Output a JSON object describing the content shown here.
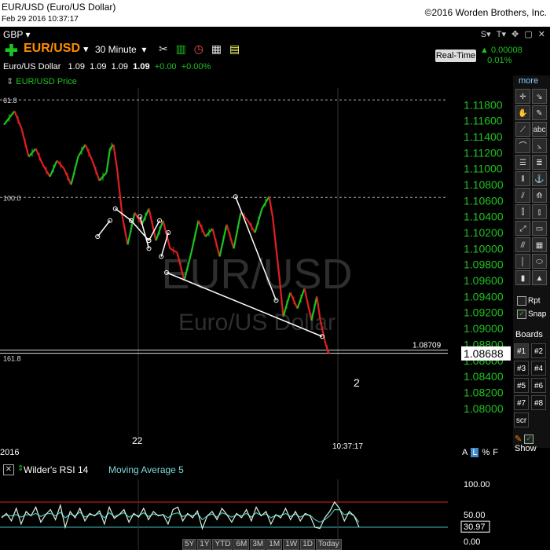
{
  "window": {
    "title": "EUR/USD (Euro/US Dollar)",
    "datetime": "Feb 29 2016 10:37:17",
    "copyright": "©2016 Worden Brothers, Inc."
  },
  "toolbar": {
    "watchlist": "GBP",
    "symbol": "EUR/USD",
    "interval": "30 Minute",
    "realtime_label": "Real-Time",
    "change_abs": "0.00008",
    "change_pct": "0.01%",
    "top_icons": [
      "S▾",
      "T▾",
      "✥",
      "▢",
      "✕"
    ],
    "tool_icons": [
      "tools-icon",
      "bar-chart-icon",
      "clock-icon",
      "grid-icon",
      "note-icon"
    ]
  },
  "quote": {
    "name": "Euro/US Dollar",
    "open": "1.09",
    "high": "1.09",
    "low": "1.09",
    "close": "1.09",
    "change": "+0.00",
    "change_pct": "+0.00%"
  },
  "price_pane": {
    "label": "EUR/USD Price",
    "watermark_symbol": "EUR/USD",
    "watermark_name": "Euro/US Dollar",
    "current_price_box": "1.08688",
    "line_value_label": "1.08709",
    "wave_label": "2",
    "date_label_left": "2016",
    "date_label_22": "22",
    "date_label_time": "10:37:17",
    "fib_labels": [
      "61.8",
      "100.0",
      "161.8"
    ]
  },
  "chart_data": {
    "type": "line",
    "title": "EUR/USD (Euro/US Dollar)",
    "interval": "30 Minute",
    "yaxis_ticks": [
      1.118,
      1.116,
      1.114,
      1.112,
      1.11,
      1.108,
      1.106,
      1.104,
      1.102,
      1.1,
      1.098,
      1.096,
      1.094,
      1.092,
      1.09,
      1.088,
      1.086,
      1.084,
      1.082,
      1.08
    ],
    "ylim": [
      1.0788,
      1.1195
    ],
    "x_labels": [
      "2016",
      "22",
      "10:37:17"
    ],
    "horizontal_lines": [
      {
        "label": "61.8",
        "value": 1.1186
      },
      {
        "label": "100.0",
        "value": 1.1064
      },
      {
        "label": "161.8",
        "value": 1.0871
      }
    ],
    "price_path": [
      [
        0,
        1.1155
      ],
      [
        0.03,
        1.1172
      ],
      [
        0.05,
        1.115
      ],
      [
        0.07,
        1.1115
      ],
      [
        0.09,
        1.1125
      ],
      [
        0.11,
        1.1105
      ],
      [
        0.13,
        1.109
      ],
      [
        0.15,
        1.111
      ],
      [
        0.17,
        1.11
      ],
      [
        0.19,
        1.108
      ],
      [
        0.21,
        1.1115
      ],
      [
        0.23,
        1.113
      ],
      [
        0.25,
        1.111
      ],
      [
        0.27,
        1.1085
      ],
      [
        0.29,
        1.1095
      ],
      [
        0.3,
        1.1125
      ],
      [
        0.31,
        1.113
      ],
      [
        0.32,
        1.11
      ],
      [
        0.335,
        1.104
      ],
      [
        0.35,
        1.1005
      ],
      [
        0.37,
        1.1045
      ],
      [
        0.39,
        1.103
      ],
      [
        0.41,
        1.105
      ],
      [
        0.43,
        1.101
      ],
      [
        0.45,
        1.1035
      ],
      [
        0.47,
        1.1
      ],
      [
        0.49,
        1.0995
      ],
      [
        0.51,
        1.096
      ],
      [
        0.53,
        1.0995
      ],
      [
        0.55,
        1.1035
      ],
      [
        0.57,
        1.1015
      ],
      [
        0.59,
        1.1025
      ],
      [
        0.61,
        1.099
      ],
      [
        0.63,
        1.103
      ],
      [
        0.65,
        1.1
      ],
      [
        0.67,
        1.1045
      ],
      [
        0.69,
        1.1035
      ],
      [
        0.71,
        1.102
      ],
      [
        0.73,
        1.105
      ],
      [
        0.75,
        1.1065
      ],
      [
        0.76,
        1.104
      ],
      [
        0.77,
        1.1
      ],
      [
        0.78,
        1.096
      ],
      [
        0.79,
        1.0915
      ],
      [
        0.81,
        1.0945
      ],
      [
        0.83,
        1.0925
      ],
      [
        0.85,
        1.095
      ],
      [
        0.87,
        1.091
      ],
      [
        0.885,
        1.094
      ],
      [
        0.895,
        1.091
      ],
      [
        0.91,
        1.088
      ],
      [
        0.92,
        1.0868
      ]
    ],
    "trendlines": [
      {
        "from": [
          0.265,
          1.1015
        ],
        "to": [
          0.3,
          1.1035
        ]
      },
      {
        "from": [
          0.315,
          1.105
        ],
        "to": [
          0.36,
          1.1035
        ]
      },
      {
        "from": [
          0.36,
          1.1035
        ],
        "to": [
          0.41,
          1.101
        ]
      },
      {
        "from": [
          0.41,
          1.101
        ],
        "to": [
          0.44,
          1.1035
        ]
      },
      {
        "from": [
          0.385,
          1.104
        ],
        "to": [
          0.41,
          1.1
        ]
      },
      {
        "from": [
          0.445,
          1.099
        ],
        "to": [
          0.465,
          1.102
        ]
      },
      {
        "from": [
          0.46,
          1.097
        ],
        "to": [
          0.9,
          1.089
        ]
      },
      {
        "from": [
          0.655,
          1.1065
        ],
        "to": [
          0.77,
          1.0935
        ]
      }
    ]
  },
  "rsi_pane": {
    "title": "Wilder's RSI 14",
    "ma_label": "Moving Average 5",
    "levels": [
      "100.00",
      "50.00",
      "0.00"
    ],
    "current": "30.97",
    "upper_line": 70,
    "lower_line": 30,
    "rsi_values": [
      45,
      52,
      40,
      60,
      35,
      55,
      48,
      62,
      38,
      50,
      58,
      42,
      65,
      30,
      55,
      45,
      60,
      40,
      52,
      48,
      56,
      35,
      62,
      44,
      50,
      58,
      38,
      52,
      46,
      60,
      42,
      55,
      48,
      50,
      35,
      58,
      62,
      40,
      52,
      45,
      56,
      28,
      48,
      55,
      42,
      60,
      50,
      38,
      52,
      45,
      58,
      40,
      62,
      48,
      55,
      35,
      50,
      45,
      60,
      42,
      55,
      40,
      52,
      48,
      30,
      28,
      45,
      55,
      70,
      60,
      40,
      55,
      48,
      30
    ],
    "ma_values": [
      47,
      49,
      48,
      50,
      46,
      50,
      49,
      52,
      47,
      51,
      52,
      48,
      54,
      45,
      51,
      48,
      54,
      46,
      50,
      49,
      52,
      45,
      53,
      47,
      50,
      53,
      46,
      50,
      48,
      53,
      47,
      51,
      49,
      50,
      45,
      51,
      53,
      47,
      50,
      48,
      52,
      42,
      48,
      51,
      46,
      53,
      50,
      46,
      50,
      48,
      52,
      46,
      53,
      49,
      51,
      45,
      49,
      48,
      52,
      47,
      51,
      46,
      50,
      49,
      42,
      38,
      42,
      48,
      58,
      58,
      50,
      52,
      48,
      38
    ]
  },
  "right_panel": {
    "more": "more",
    "rpt": "Rpt",
    "snap": "Snap",
    "boards": "Boards",
    "board_buttons": [
      "#1",
      "#2",
      "#3",
      "#4",
      "#5",
      "#6",
      "#7",
      "#8",
      "scr"
    ],
    "show": "Show",
    "tool_glyphs": [
      "✛",
      "⇘",
      "✋",
      "✎",
      "⟋",
      "abc",
      "⌒",
      "⦣",
      "☰",
      "≣",
      "⫴",
      "⚓",
      "⫽",
      "⟰",
      "⫿",
      "⫾",
      "⤢",
      "▭",
      "⫻",
      "▦",
      "│",
      "⬭",
      "▮",
      "▲"
    ]
  },
  "scale_controls": [
    "A",
    "L",
    "%",
    "F"
  ],
  "bottom_buttons": [
    "5Y",
    "1Y",
    "YTD",
    "6M",
    "3M",
    "1M",
    "1W",
    "1D",
    "Today"
  ]
}
